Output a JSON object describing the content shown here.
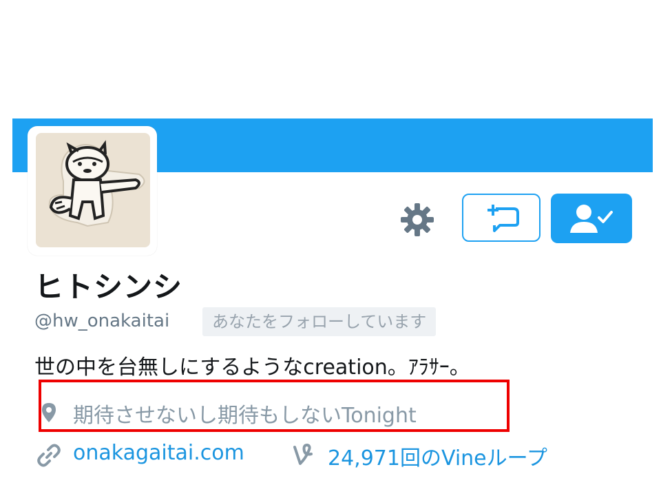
{
  "colors": {
    "accent": "#1da1f2",
    "banner": "#1da1f2",
    "link": "#1b95e0",
    "highlight_box": "#ee0000",
    "muted_text": "#8899a6"
  },
  "profile": {
    "display_name": "ヒトシンシ",
    "handle": "@hw_onakaitai",
    "follows_you_badge": "あなたをフォローしています",
    "bio": "世の中を台無しにするようなcreation。ｱﾗｻｰ。",
    "location": "期待させないし期待もしないTonight",
    "website": "onakagaitai.com",
    "vine_loops": "24,971回のVineループ"
  },
  "actions": {
    "settings_icon": "gear-icon",
    "message_icon": "direct-message-icon",
    "following_icon": "user-check-icon"
  },
  "icons": {
    "location": "map-pin-icon",
    "website": "link-icon",
    "vine": "vine-icon"
  }
}
